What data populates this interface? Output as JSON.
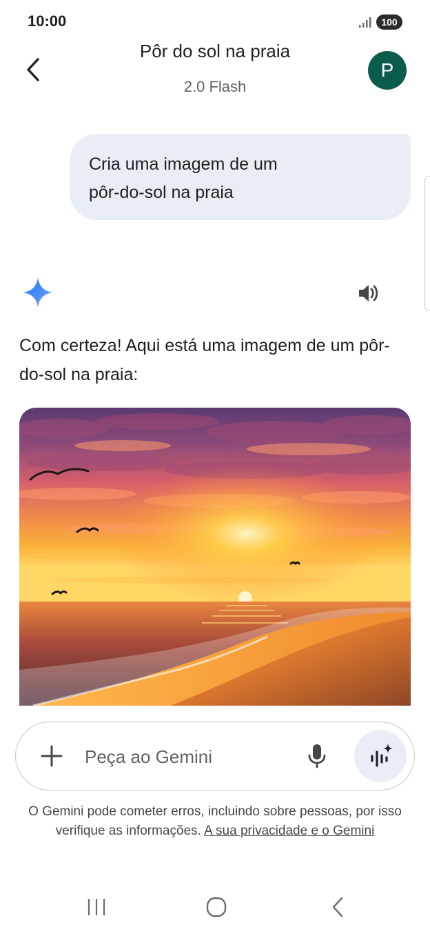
{
  "status_bar": {
    "time": "10:00",
    "battery": "100",
    "signal_icon": "signal-bars-icon"
  },
  "header": {
    "title": "Pôr do sol na praia",
    "subtitle": "2.0 Flash",
    "avatar_letter": "P",
    "avatar_color": "#0b5d4b",
    "back_icon": "chevron-left-icon"
  },
  "conversation": {
    "user_message": "Cria uma imagem de um\npôr-do-sol na praia",
    "assistant_icon": "gemini-sparkle-icon",
    "read_aloud_icon": "speaker-icon",
    "assistant_text": "Com certeza! Aqui está uma imagem de um pôr-do-sol na praia:",
    "image_subject": "sunset-beach-image"
  },
  "composer": {
    "placeholder": "Peça ao Gemini",
    "add_icon": "plus-icon",
    "mic_icon": "microphone-icon",
    "live_icon": "gemini-live-icon"
  },
  "disclaimer": {
    "text": "O Gemini pode cometer erros, incluindo sobre pessoas, por isso verifique as informações. ",
    "link": "A sua privacidade e o Gemini"
  },
  "nav_bar": {
    "recents_icon": "recents-icon",
    "home_icon": "home-icon",
    "back_icon": "back-icon"
  },
  "colors": {
    "user_bubble": "#e9eef6",
    "text_primary": "#1f1f1f",
    "text_secondary": "#5f6368",
    "gemini_blue": "#4285f4"
  }
}
